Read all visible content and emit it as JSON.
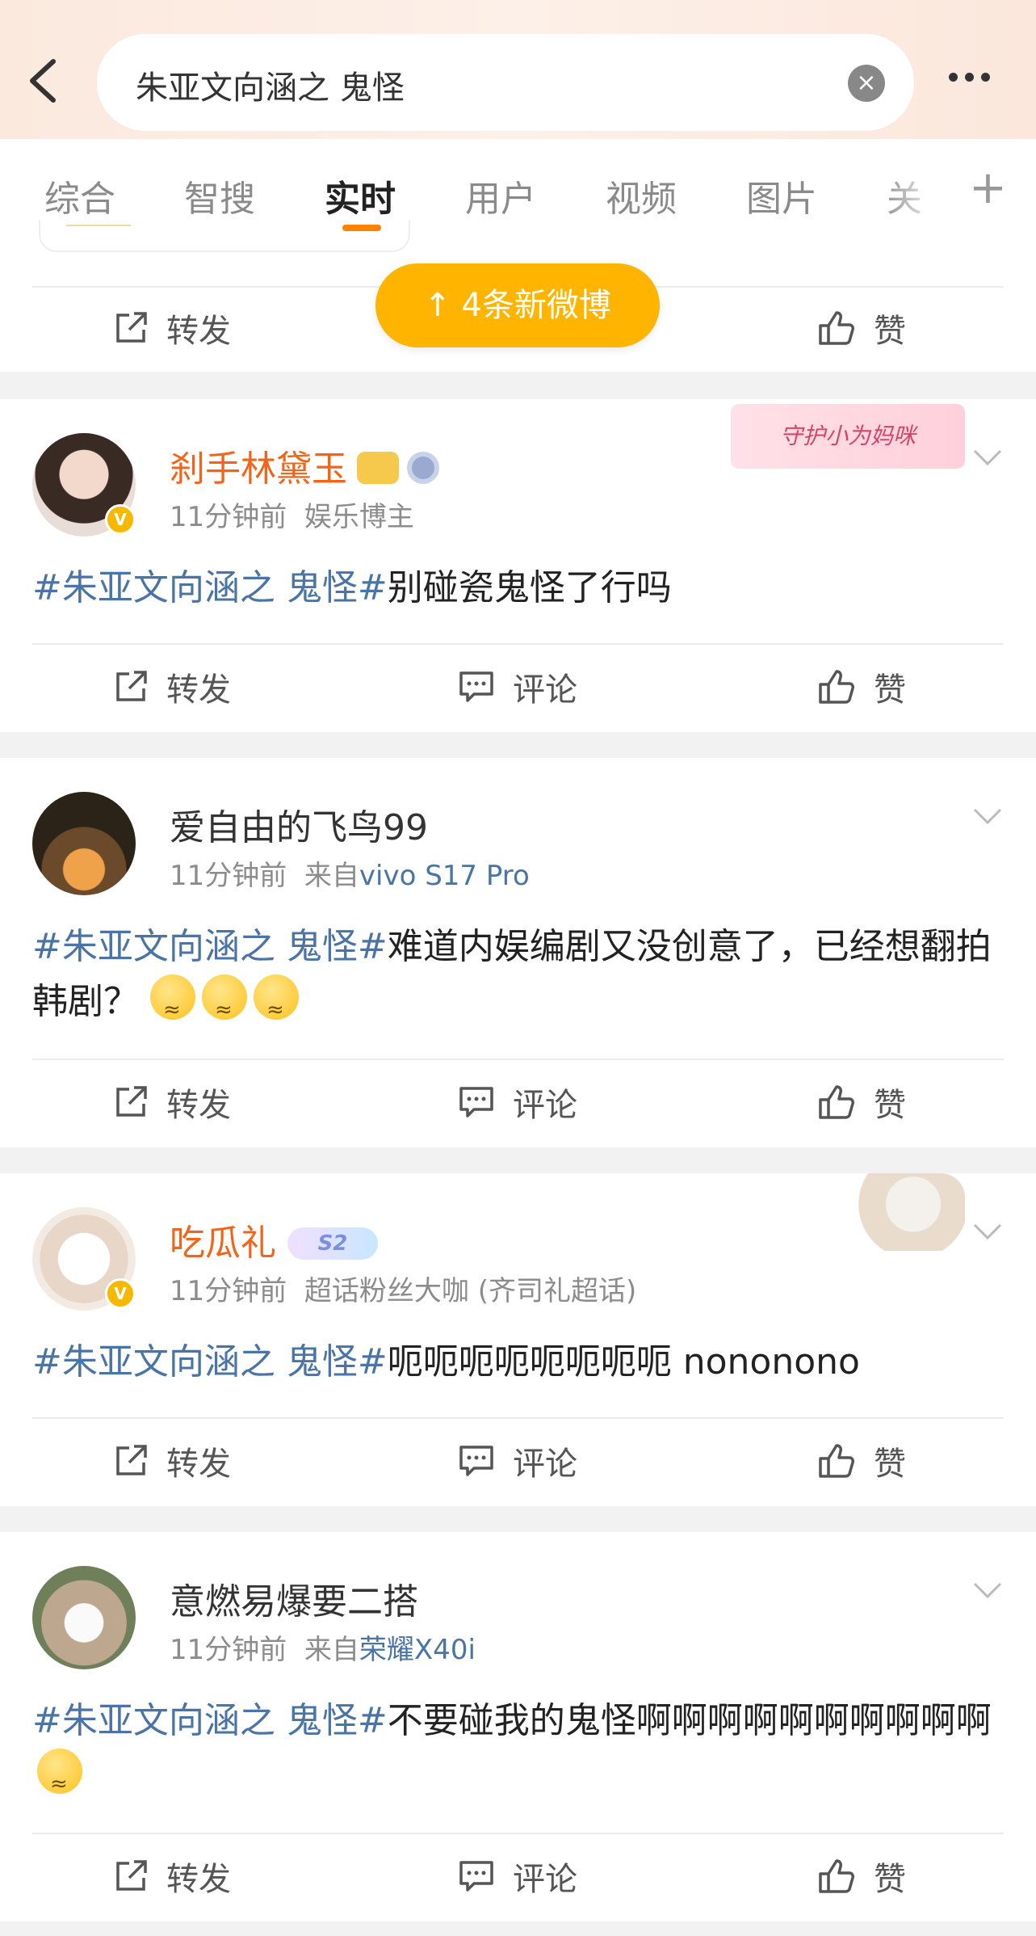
{
  "search": {
    "query": "朱亚文向涵之 鬼怪"
  },
  "tabs": [
    "综合",
    "智搜",
    "实时",
    "用户",
    "视频",
    "图片",
    "关"
  ],
  "new_posts_pill": "↑  4条新微博",
  "actions": {
    "repost": "转发",
    "comment": "评论",
    "like": "赞"
  },
  "posts": [
    {
      "username": "刹手林黛玉",
      "time": "11分钟前",
      "meta": "娱乐博主",
      "tag": "#朱亚文向涵之 鬼怪#",
      "text": "别碰瓷鬼怪了行吗",
      "decoration": "守护小为妈咪"
    },
    {
      "username": "爱自由的飞鸟99",
      "time": "11分钟前",
      "source_prefix": "来自",
      "source": "vivo S17 Pro",
      "tag": "#朱亚文向涵之 鬼怪#",
      "text": "难道内娱编剧又没创意了，已经想翻拍韩剧？"
    },
    {
      "username": "吃瓜礼",
      "badge": "S2",
      "time": "11分钟前",
      "meta": "超话粉丝大咖 (齐司礼超话)",
      "tag": "#朱亚文向涵之 鬼怪#",
      "text": "呃呃呃呃呃呃呃呃 nononono"
    },
    {
      "username": "意燃易爆要二搭",
      "time": "11分钟前",
      "source_prefix": "来自",
      "source": "荣耀X40i",
      "tag": "#朱亚文向涵之 鬼怪#",
      "text": "不要碰我的鬼怪啊啊啊啊啊啊啊啊啊啊"
    }
  ]
}
